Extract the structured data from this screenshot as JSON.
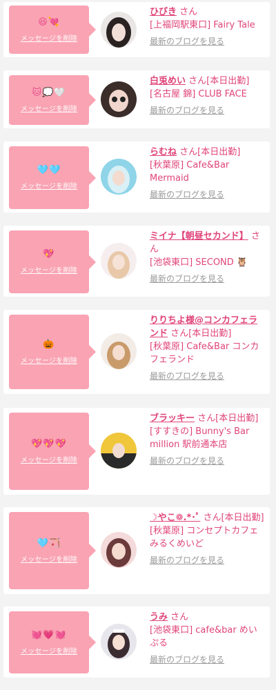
{
  "delete_label": "メッセージを削除",
  "blog_label": "最新のブログを見る",
  "entries": [
    {
      "emoji": "😆💘",
      "name": "ひびき",
      "suffix": "さん",
      "shop": "[上福岡駅東口] Fairy Tale"
    },
    {
      "emoji": "🐱💭🤍",
      "name": "白兎めい",
      "suffix": "さん[本日出勤]",
      "shop": "[名古屋 錦] CLUB FACE"
    },
    {
      "emoji": "🩵🩵",
      "name": "らむね",
      "suffix": "さん[本日出勤]",
      "shop": "[秋葉原] Cafe&Bar Mermaid"
    },
    {
      "emoji": "💖",
      "name": "ミイナ【朝昼セカンド】",
      "suffix": "さん",
      "shop": "[池袋東口] SECOND 🦉"
    },
    {
      "emoji": "🎃",
      "name": "りりちよ様@コンカフェランド",
      "suffix": "さん[本日出勤]",
      "shop": "[秋葉原] Cafe&Bar コンカフェランド"
    },
    {
      "emoji": "💖💖💖",
      "name": "ブラッキー",
      "suffix": "さん[本日出勤]",
      "shop": "[すすきの] Bunny's Bar million 駅前通本店"
    },
    {
      "emoji": "🩵🏹",
      "name": "☽やこ❁.*･ﾟ",
      "suffix": "さん[本日出勤]",
      "shop": "[秋葉原] コンセプトカフェ みるくめいど"
    },
    {
      "emoji": "💓💗💓",
      "name": "うみ",
      "suffix": "さん",
      "shop": "[池袋東口] cafe&bar めいぷる"
    }
  ],
  "colors": {
    "accent": "#e0447a",
    "bubble": "#f9a3b3",
    "muted": "#9a9a9a"
  }
}
